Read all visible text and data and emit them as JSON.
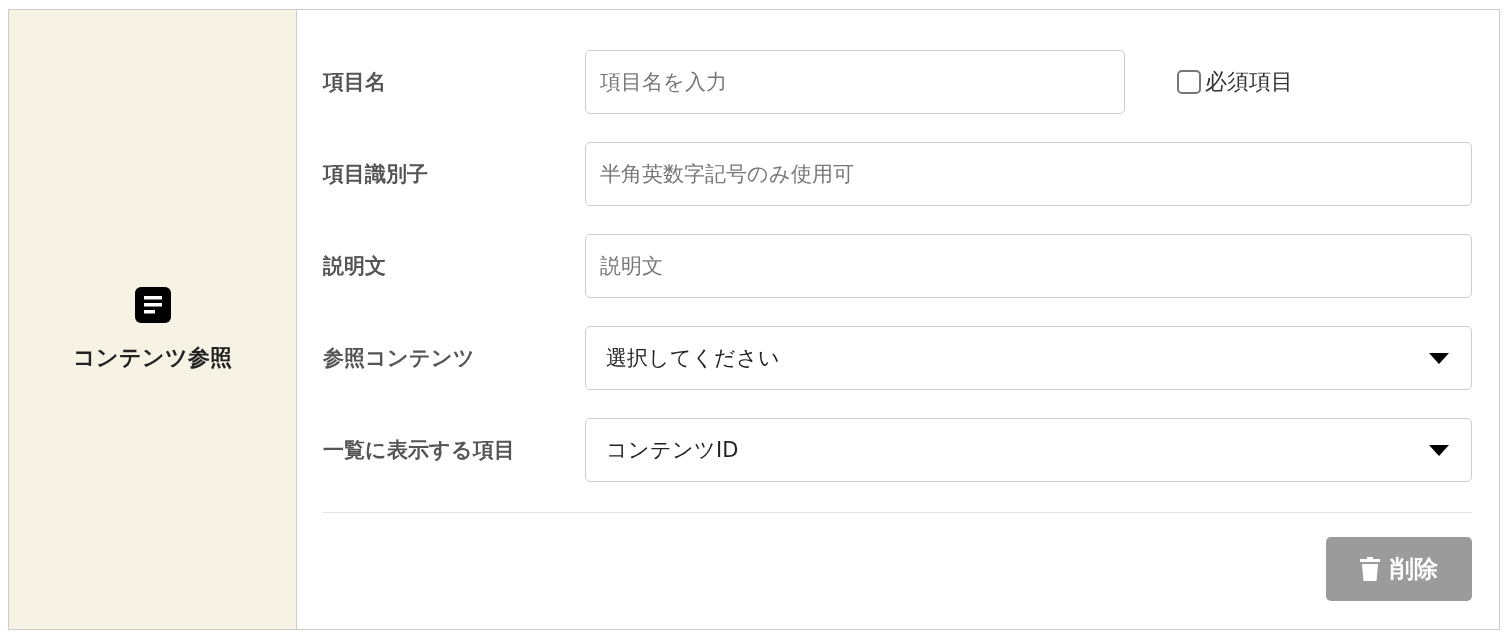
{
  "side_panel": {
    "title": "コンテンツ参照"
  },
  "fields": [
    {
      "label": "項目名",
      "kind": "text",
      "placeholder": "項目名を入力",
      "required_checkbox": {
        "label": "必須項目",
        "checked": false
      }
    },
    {
      "label": "項目識別子",
      "kind": "text",
      "placeholder": "半角英数字記号のみ使用可"
    },
    {
      "label": "説明文",
      "kind": "text",
      "placeholder": "説明文"
    },
    {
      "label": "参照コンテンツ",
      "kind": "select",
      "value": "選択してください"
    },
    {
      "label": "一覧に表示する項目",
      "kind": "select",
      "value": "コンテンツID"
    }
  ],
  "delete_button": {
    "label": "削除",
    "disabled": true
  }
}
